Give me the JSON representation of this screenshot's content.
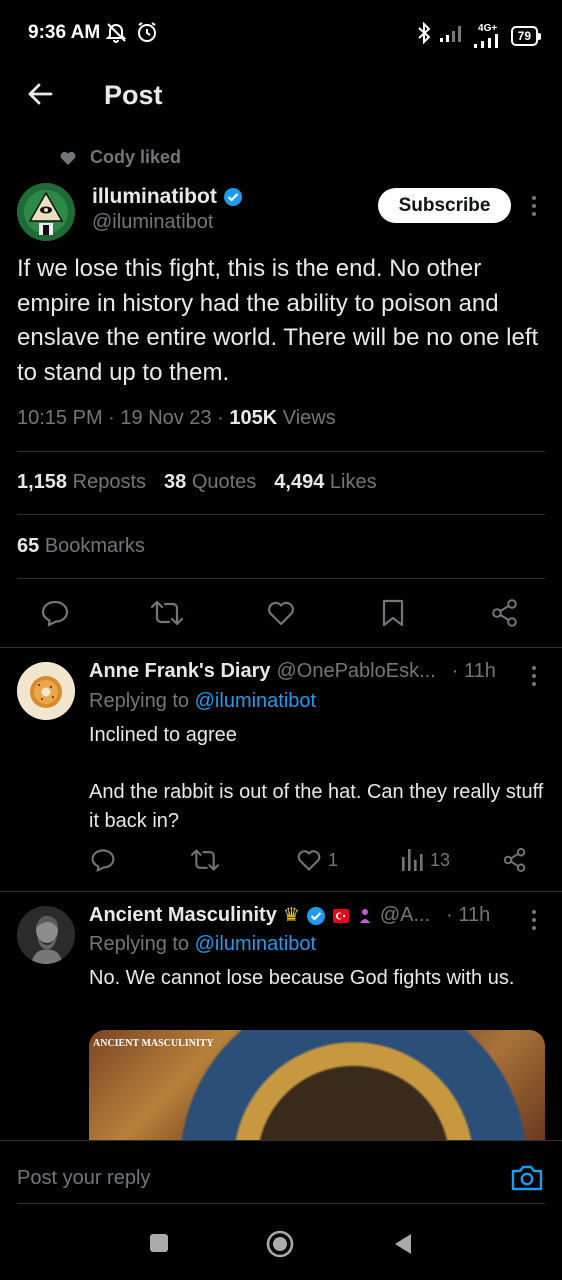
{
  "status_bar": {
    "time": "9:36 AM",
    "network": "4G+",
    "battery": "79"
  },
  "header": {
    "title": "Post"
  },
  "social_context": {
    "text": "Cody liked"
  },
  "post": {
    "author_name": "illuminatibot",
    "author_handle": "@iluminatibot",
    "verified": true,
    "subscribe_label": "Subscribe",
    "text": "If we lose this fight, this is the end. No other empire in history had the ability to poison and enslave the entire world. There will be no one left to stand up to them.",
    "time": "10:15 PM",
    "date": "19 Nov 23",
    "views_count": "105K",
    "views_label": "Views",
    "reposts_count": "1,158",
    "reposts_label": "Reposts",
    "quotes_count": "38",
    "quotes_label": "Quotes",
    "likes_count": "4,494",
    "likes_label": "Likes",
    "bookmarks_count": "65",
    "bookmarks_label": "Bookmarks"
  },
  "replies": [
    {
      "name": "Anne Frank's Diary",
      "handle": "@OnePabloEsk...",
      "time": "· 11h",
      "replying_prefix": "Replying to",
      "replying_to": "@iluminatibot",
      "text_line1": "Inclined to agree",
      "text_line2": "And the rabbit is out of the hat. Can they really stuff it back in?",
      "likes": "1",
      "views": "13"
    },
    {
      "name": "Ancient Masculinity",
      "handle": "@A...",
      "time": "· 11h",
      "replying_prefix": "Replying to",
      "replying_to": "@iluminatibot",
      "text": "No. We cannot lose because God fights with us.",
      "media_caption": "ANCIENT MASCULINITY"
    }
  ],
  "composer": {
    "placeholder": "Post your reply"
  },
  "colors": {
    "accent": "#1d9bf0",
    "background": "#000000",
    "muted": "#71767b",
    "text": "#e7e9ea"
  }
}
